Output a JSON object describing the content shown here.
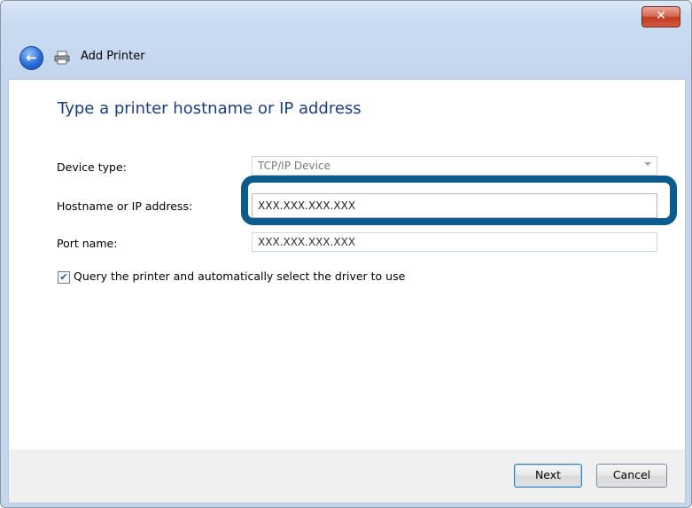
{
  "window": {
    "title": "Add Printer",
    "close_glyph": "✕",
    "back_glyph": "←",
    "icons": {
      "back": "back-arrow-icon",
      "printer": "printer-icon",
      "close": "close-icon"
    }
  },
  "main": {
    "heading": "Type a printer hostname or IP address",
    "device_type": {
      "label": "Device type:",
      "value": "TCP/IP Device"
    },
    "hostname": {
      "label": "Hostname or IP address:",
      "value": "XXX.XXX.XXX.XXX"
    },
    "port_name": {
      "label": "Port name:",
      "value": "XXX.XXX.XXX.XXX"
    },
    "query_checkbox": {
      "checked_glyph": "✔",
      "label": "Query the printer and automatically select the driver to use",
      "checked": true
    }
  },
  "footer": {
    "next_label": "Next",
    "cancel_label": "Cancel"
  },
  "colors": {
    "highlight_border": "#0b5c8c",
    "heading": "#1e3d7b"
  }
}
